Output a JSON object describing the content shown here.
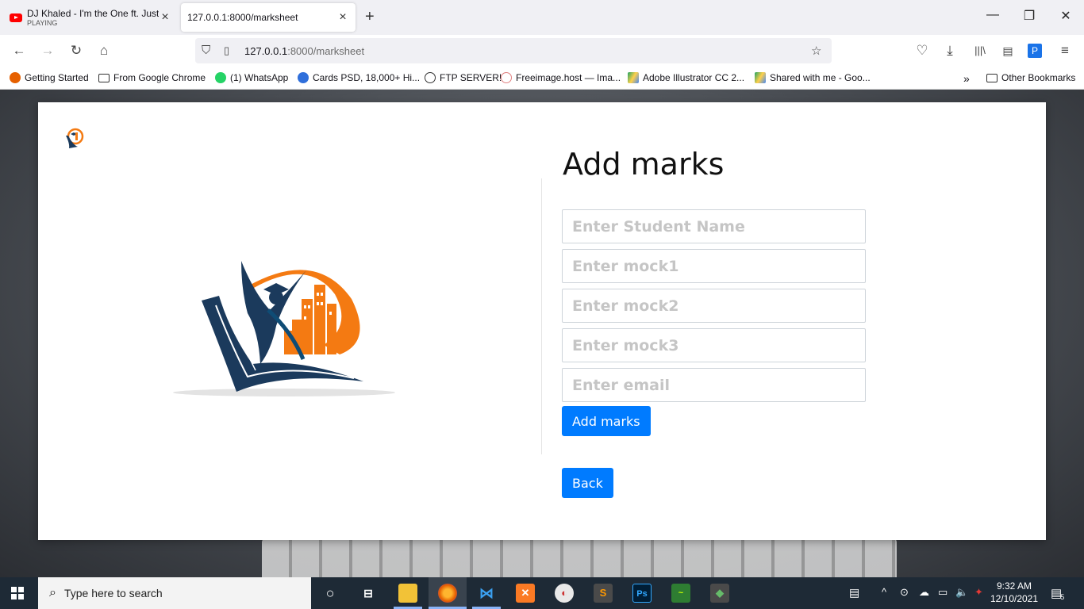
{
  "browser": {
    "tabs": [
      {
        "title": "DJ Khaled - I'm the One ft. Justi",
        "subtitle": "PLAYING"
      },
      {
        "title": "127.0.0.1:8000/marksheet"
      }
    ],
    "url_host": "127.0.0.1",
    "url_path": ":8000/marksheet",
    "bookmarks": [
      "Getting Started",
      "From Google Chrome",
      "(1) WhatsApp",
      "Cards PSD, 18,000+ Hi...",
      "FTP SERVER!",
      "Freeimage.host — Ima...",
      "Adobe Illustrator CC 2...",
      "Shared with me - Goo..."
    ],
    "other_bookmarks": "Other Bookmarks"
  },
  "page": {
    "heading": "Add marks",
    "fields": {
      "name_placeholder": "Enter Student Name",
      "mock1_placeholder": "Enter mock1",
      "mock2_placeholder": "Enter mock2",
      "mock3_placeholder": "Enter mock3",
      "email_placeholder": "Enter email"
    },
    "submit_label": "Add marks",
    "back_label": "Back",
    "accent": "#007bff",
    "logo_colors": {
      "navy": "#1b3a5c",
      "orange": "#f47a12"
    }
  },
  "taskbar": {
    "search_placeholder": "Type here to search",
    "time": "9:32 AM",
    "date": "12/10/2021",
    "notifications": "5"
  }
}
